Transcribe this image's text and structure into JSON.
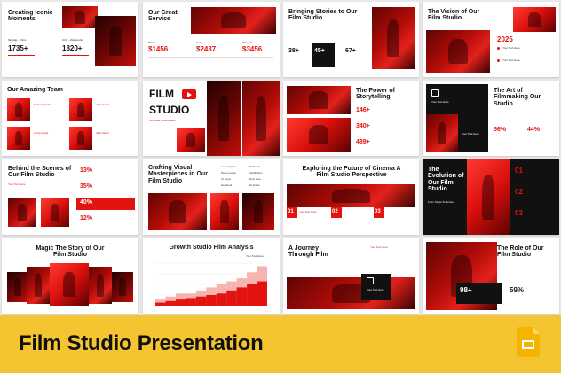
{
  "footer": {
    "title": "Film Studio Presentation",
    "app_icon": "google-slides-icon"
  },
  "colors": {
    "accent": "#e3130f",
    "footer": "#f5c431",
    "dark": "#111111"
  },
  "slides": {
    "s1": {
      "title": "Creating Iconic Moments",
      "label_a": "Monday - Films",
      "label_b": "Only - Weekends",
      "num_a": "1735+",
      "num_b": "1820+"
    },
    "s2": {
      "title": "Our Great Service",
      "tier_a": "Basic",
      "tier_b": "Gold",
      "tier_c": "Premium",
      "price_a": "$1456",
      "price_b": "$2437",
      "price_c": "$3456"
    },
    "s3": {
      "title": "Bringing Stories to Our Film Studio",
      "n1": "38+",
      "n2": "45+",
      "n3": "67+"
    },
    "s4": {
      "title": "The Vision of Our Film Studio",
      "year": "2025",
      "item_a": "Your Text Here",
      "item_b": "Your Text Here"
    },
    "s5": {
      "title": "Our Amazing Team",
      "name_a": "Michael Smith",
      "name_b": "Jack Sarah",
      "name_c": "Lucky Maria",
      "name_d": "Jack Sarah"
    },
    "s6": {
      "title_a": "FILM",
      "title_b": "STUDIO",
      "subtitle": "Template Presentation"
    },
    "s7": {
      "title": "The Power of Storytelling",
      "n1": "146+",
      "n2": "340+",
      "n3": "489+"
    },
    "s8": {
      "title": "The Art of Filmmaking Our Studio",
      "n1": "56%",
      "n2": "44%",
      "label": "Your Text Here",
      "label_b": "Your Text Here"
    },
    "s9": {
      "title": "Behind the Scenes of Our Film Studio",
      "p1": "13%",
      "p2": "35%",
      "p3": "40%",
      "p4": "12%",
      "label": "Your Text Here"
    },
    "s10": {
      "title": "Crafting Visual Masterpieces in Our Film Studio",
      "items": [
        "Lorem ipsum",
        "Nam et enim",
        "Ut turpis",
        "Hendrerit",
        "Nulla nisi",
        "Vestibulum",
        "Duis aute",
        "Et dolore"
      ]
    },
    "s11": {
      "title": "Exploring the Future of Cinema A Film Studio Perspective",
      "n1": "01",
      "n2": "02",
      "n3": "03",
      "label": "Your Text Here"
    },
    "s12": {
      "title": "The Evolution of Our Film Studio",
      "label": "From Script To Screen",
      "n1": "01",
      "n2": "02",
      "n3": "03"
    },
    "s13": {
      "title": "Magic The Story of Our Film Studio"
    },
    "s14": {
      "title": "Growth Studio Film Analysis",
      "legend": "Your Text Here"
    },
    "s15": {
      "title": "A Journey Through Film",
      "label": "Your Text Here",
      "label_b": "Your Text Here"
    },
    "s16": {
      "title": "The Role of Our Film Studio",
      "n1": "98+",
      "n2": "59%"
    }
  },
  "chart_data": {
    "type": "area",
    "title": "Growth Studio Film Analysis",
    "series": [
      {
        "values": [
          2,
          3,
          4,
          4,
          5,
          6,
          7,
          8,
          9,
          11,
          13
        ]
      },
      {
        "values": [
          1,
          1.5,
          2,
          2.5,
          3,
          3.5,
          4,
          5,
          6,
          7,
          8
        ]
      }
    ],
    "ylim": [
      0,
      14
    ]
  }
}
